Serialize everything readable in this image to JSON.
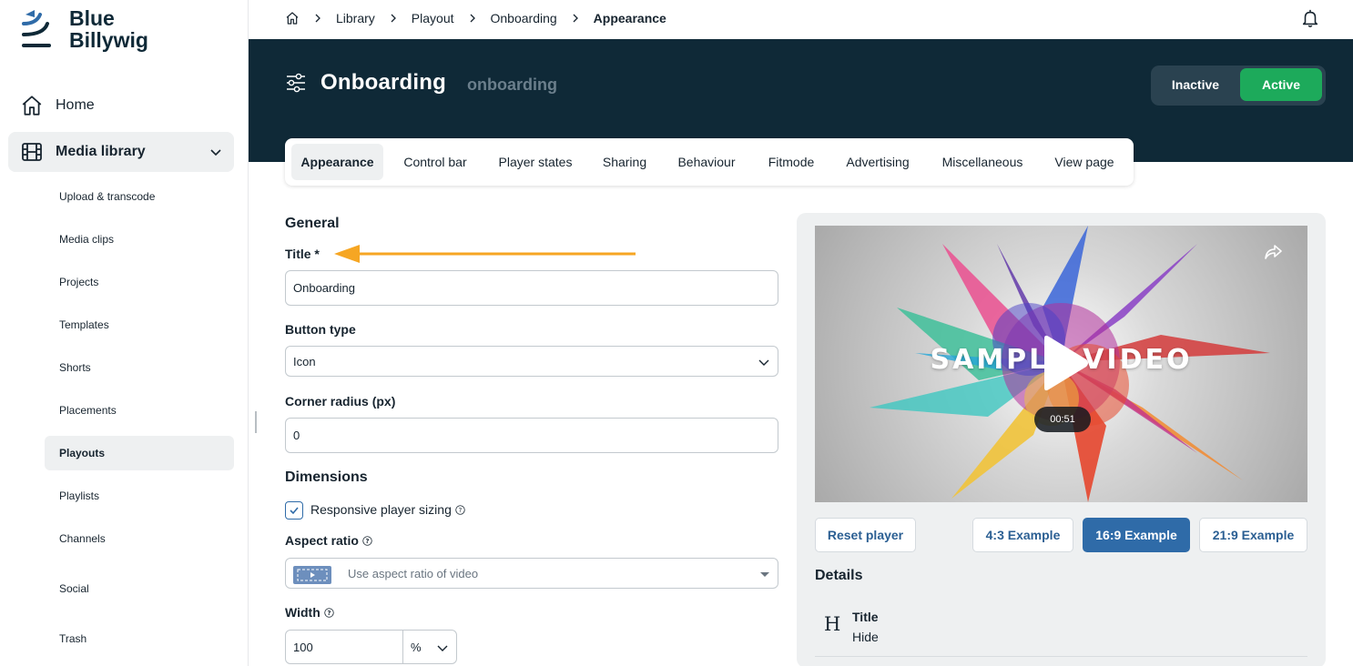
{
  "brand": {
    "line1": "Blue",
    "line2": "Billywig",
    "logo_icon": "blue-billywig-logo"
  },
  "sidebar": {
    "home_label": "Home",
    "media_label": "Media library",
    "items": [
      {
        "label": "Upload & transcode",
        "active": false
      },
      {
        "label": "Media clips",
        "active": false
      },
      {
        "label": "Projects",
        "active": false
      },
      {
        "label": "Templates",
        "active": false
      },
      {
        "label": "Shorts",
        "active": false
      },
      {
        "label": "Placements",
        "active": false
      },
      {
        "label": "Playouts",
        "active": true
      },
      {
        "label": "Playlists",
        "active": false
      },
      {
        "label": "Channels",
        "active": false
      },
      {
        "label": "Social",
        "active": false
      },
      {
        "label": "Trash",
        "active": false
      }
    ]
  },
  "breadcrumb": [
    "Library",
    "Playout",
    "Onboarding",
    "Appearance"
  ],
  "header": {
    "title": "Onboarding",
    "slug": "onboarding",
    "inactive_label": "Inactive",
    "active_label": "Active",
    "active_color": "#1daa5b"
  },
  "tabs": [
    "Appearance",
    "Control bar",
    "Player states",
    "Sharing",
    "Behaviour",
    "Fitmode",
    "Advertising",
    "Miscellaneous",
    "View page"
  ],
  "form": {
    "general_heading": "General",
    "title_label": "Title *",
    "title_value": "Onboarding",
    "button_type_label": "Button type",
    "button_type_value": "Icon",
    "corner_radius_label": "Corner radius (px)",
    "corner_radius_value": "0",
    "dimensions_heading": "Dimensions",
    "responsive_label": "Responsive player sizing",
    "responsive_checked": true,
    "aspect_label": "Aspect ratio",
    "aspect_value": "Use aspect ratio of video",
    "width_label": "Width",
    "width_value": "100",
    "width_unit": "%"
  },
  "preview": {
    "video_text": "SAMPLE VIDEO",
    "duration": "00:51",
    "reset_label": "Reset player",
    "examples": [
      "4:3 Example",
      "16:9 Example",
      "21:9 Example"
    ],
    "selected_example": "16:9 Example",
    "details_heading": "Details",
    "detail_title": "Title",
    "detail_value": "Hide"
  },
  "annotation_color": "#f6a623",
  "accent": "#2f6ba8",
  "header_bg": "#0f2937"
}
